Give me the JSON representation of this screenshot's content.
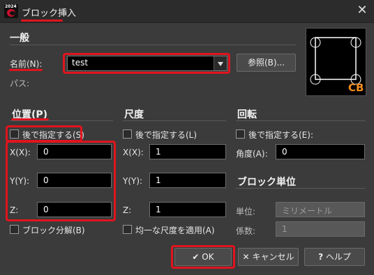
{
  "window": {
    "title": "ブロック挿入",
    "app_icon_year": "2024"
  },
  "general": {
    "header": "一般",
    "name_label": "名前(N):",
    "name_value": "test",
    "browse_button": "参照(B)...",
    "path_label": "パス:",
    "preview_watermark": "CB"
  },
  "position": {
    "header": "位置(P)",
    "specify_later": "後で指定する(S)",
    "x_label": "X(X):",
    "x_value": "0",
    "y_label": "Y(Y):",
    "y_value": "0",
    "z_label": "Z:",
    "z_value": "0",
    "explode_label": "ブロック分解(B)"
  },
  "scale": {
    "header": "尺度",
    "specify_later": "後で指定する(L)",
    "x_label": "X(X):",
    "x_value": "1",
    "y_label": "Y(Y):",
    "y_value": "1",
    "z_label": "Z:",
    "z_value": "1",
    "uniform_label": "均一な尺度を適用(A)"
  },
  "rotation": {
    "header": "回転",
    "specify_later": "後で指定する(E):",
    "angle_label": "角度(A):",
    "angle_value": "0"
  },
  "block_unit": {
    "header": "ブロック単位",
    "unit_label": "単位:",
    "unit_value": "ミリメートル",
    "factor_label": "係数:",
    "factor_value": "1"
  },
  "buttons": {
    "ok": "OK",
    "cancel": "キャンセル",
    "help": "ヘルプ"
  },
  "colors": {
    "highlight": "#e0141e",
    "watermark": "#f08c1e"
  }
}
